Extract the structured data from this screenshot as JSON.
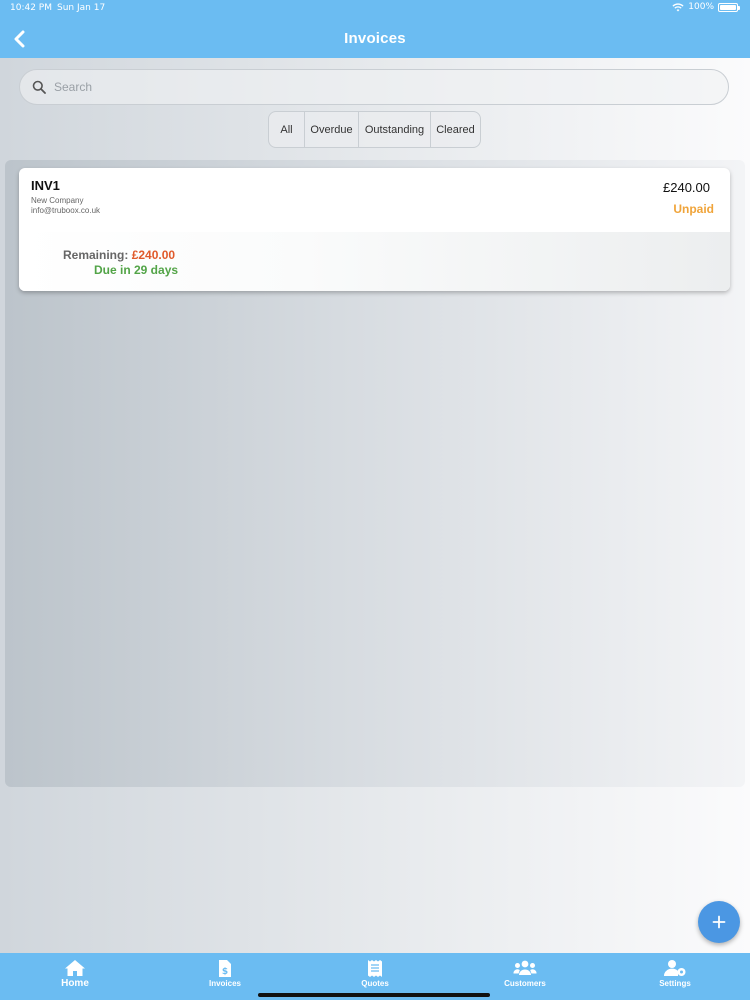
{
  "status_bar": {
    "time": "10:42 PM",
    "date": "Sun Jan 17",
    "battery": "100%"
  },
  "header": {
    "title": "Invoices"
  },
  "search": {
    "placeholder": "Search"
  },
  "filters": [
    {
      "label": "All"
    },
    {
      "label": "Overdue"
    },
    {
      "label": "Outstanding"
    },
    {
      "label": "Cleared"
    }
  ],
  "invoices": [
    {
      "number": "INV1",
      "company": "New Company",
      "email": "info@truboox.co.uk",
      "amount": "£240.00",
      "status": "Unpaid",
      "remaining_label": "Remaining:",
      "remaining_value": "£240.00",
      "due": "Due in 29 days"
    }
  ],
  "tabbar": [
    {
      "label": "Home",
      "icon": "home-icon"
    },
    {
      "label": "Invoices",
      "icon": "invoice-icon"
    },
    {
      "label": "Quotes",
      "icon": "receipt-icon"
    },
    {
      "label": "Customers",
      "icon": "users-icon"
    },
    {
      "label": "Settings",
      "icon": "user-settings-icon"
    }
  ],
  "colors": {
    "header": "#6bbcf2",
    "status_unpaid": "#f0a43a",
    "remaining": "#e05a2b",
    "due": "#52a447",
    "fab": "#4b97e3"
  }
}
